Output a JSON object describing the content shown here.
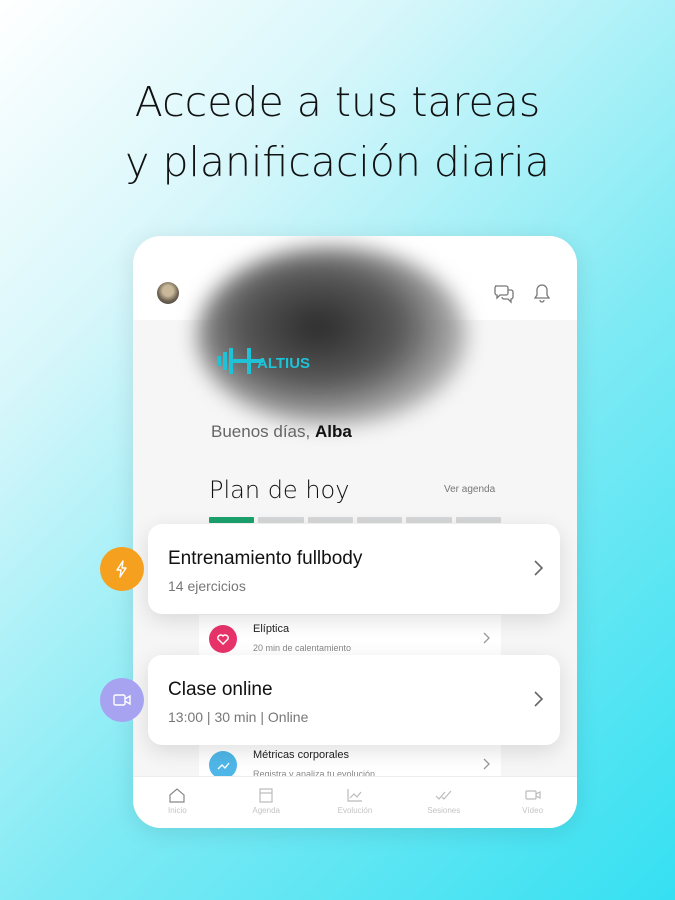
{
  "headline": {
    "line1": "Accede a tus tareas",
    "line2": "y planificación diaria"
  },
  "app": {
    "logo_text": "ALTIUS",
    "greeting_prefix": "Buenos días,",
    "greeting_name": "Alba",
    "plan_title": "Plan de hoy",
    "ver_agenda": "Ver agenda",
    "progress": {
      "completed_segments": 1,
      "total_segments": 6
    },
    "inner_items": [
      {
        "title": "Elíptica",
        "subtitle": "20 min de calentamiento",
        "icon": "heart-icon",
        "color": "#e8336a"
      },
      {
        "title": "Métricas corporales",
        "subtitle": "Registra y analiza tu evolución",
        "icon": "chart-icon",
        "color": "#4fb7e8"
      }
    ],
    "cards": [
      {
        "title": "Entrenamiento fullbody",
        "subtitle": "14 ejercicios",
        "badge_icon": "lightning-icon",
        "badge_color": "#f5a01e"
      },
      {
        "title": "Clase online",
        "subtitle": "13:00 | 30 min | Online",
        "badge_icon": "video-icon",
        "badge_color": "#a7a3f0"
      }
    ],
    "tabs": [
      {
        "label": "Inicio",
        "icon": "home-icon"
      },
      {
        "label": "Agenda",
        "icon": "calendar-icon"
      },
      {
        "label": "Evolución",
        "icon": "trend-icon"
      },
      {
        "label": "Sesiones",
        "icon": "checks-icon"
      },
      {
        "label": "Vídeo",
        "icon": "video-icon"
      }
    ]
  },
  "colors": {
    "accent_green": "#1ba16d",
    "text_dark": "#111111"
  }
}
